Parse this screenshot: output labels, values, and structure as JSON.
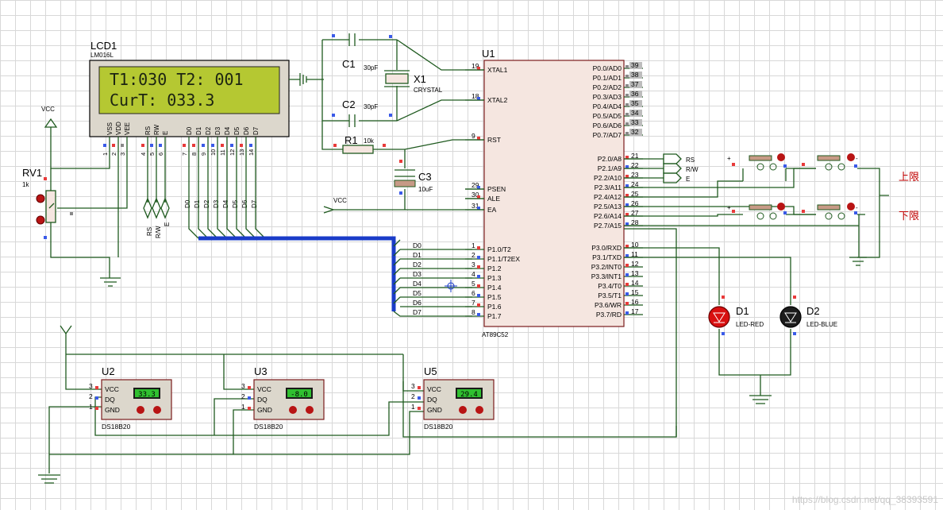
{
  "lcd": {
    "ref": "LCD1",
    "model": "LM016L",
    "line1": "T1:030 T2: 001",
    "line2": "CurT: 033.3",
    "pins": [
      "VSS",
      "VDD",
      "VEE",
      "RS",
      "RW",
      "E",
      "D0",
      "D1",
      "D2",
      "D3",
      "D4",
      "D5",
      "D6",
      "D7"
    ],
    "pin_numbers": [
      "1",
      "2",
      "3",
      "4",
      "5",
      "6",
      "7",
      "8",
      "9",
      "10",
      "11",
      "12",
      "13",
      "14"
    ],
    "lower_labels": [
      "RS",
      "R/W",
      "E",
      "D0",
      "D1",
      "D2",
      "D3",
      "D4",
      "D5",
      "D6",
      "D7"
    ]
  },
  "mcu": {
    "ref": "U1",
    "model": "AT89C52",
    "left_pins": [
      {
        "num": "19",
        "name": "XTAL1"
      },
      {
        "num": "18",
        "name": "XTAL2"
      },
      {
        "num": "9",
        "name": "RST"
      },
      {
        "num": "29",
        "name": "PSEN"
      },
      {
        "num": "30",
        "name": "ALE"
      },
      {
        "num": "31",
        "name": "EA"
      },
      {
        "num": "1",
        "name": "P1.0/T2"
      },
      {
        "num": "2",
        "name": "P1.1/T2EX"
      },
      {
        "num": "3",
        "name": "P1.2"
      },
      {
        "num": "4",
        "name": "P1.3"
      },
      {
        "num": "5",
        "name": "P1.4"
      },
      {
        "num": "6",
        "name": "P1.5"
      },
      {
        "num": "7",
        "name": "P1.6"
      },
      {
        "num": "8",
        "name": "P1.7"
      }
    ],
    "right_pins": [
      {
        "num": "39",
        "name": "P0.0/AD0"
      },
      {
        "num": "38",
        "name": "P0.1/AD1"
      },
      {
        "num": "37",
        "name": "P0.2/AD2"
      },
      {
        "num": "36",
        "name": "P0.3/AD3"
      },
      {
        "num": "35",
        "name": "P0.4/AD4"
      },
      {
        "num": "34",
        "name": "P0.5/AD5"
      },
      {
        "num": "33",
        "name": "P0.6/AD6"
      },
      {
        "num": "32",
        "name": "P0.7/AD7"
      },
      {
        "num": "21",
        "name": "P2.0/A8"
      },
      {
        "num": "22",
        "name": "P2.1/A9"
      },
      {
        "num": "23",
        "name": "P2.2/A10"
      },
      {
        "num": "24",
        "name": "P2.3/A11"
      },
      {
        "num": "25",
        "name": "P2.4/A12"
      },
      {
        "num": "26",
        "name": "P2.5/A13"
      },
      {
        "num": "27",
        "name": "P2.6/A14"
      },
      {
        "num": "28",
        "name": "P2.7/A15"
      },
      {
        "num": "10",
        "name": "P3.0/RXD"
      },
      {
        "num": "11",
        "name": "P3.1/TXD"
      },
      {
        "num": "12",
        "name": "P3.2/INT0"
      },
      {
        "num": "13",
        "name": "P3.3/INT1"
      },
      {
        "num": "14",
        "name": "P3.4/T0"
      },
      {
        "num": "15",
        "name": "P3.5/T1"
      },
      {
        "num": "16",
        "name": "P3.6/WR"
      },
      {
        "num": "17",
        "name": "P3.7/RD"
      }
    ]
  },
  "bus_labels": [
    "D0",
    "D1",
    "D2",
    "D3",
    "D4",
    "D5",
    "D6",
    "D7"
  ],
  "port2_labels": [
    "RS",
    "R/W",
    "E"
  ],
  "crystal": {
    "ref": "X1",
    "value": "CRYSTAL"
  },
  "caps": [
    {
      "ref": "C1",
      "value": "30pF"
    },
    {
      "ref": "C2",
      "value": "30pF"
    },
    {
      "ref": "C3",
      "value": "10uF"
    }
  ],
  "resistor": {
    "ref": "R1",
    "value": "10k"
  },
  "pot": {
    "ref": "RV1",
    "value": "1k"
  },
  "vcc": "VCC",
  "leds": [
    {
      "ref": "D1",
      "value": "LED-RED",
      "color": "#d81010"
    },
    {
      "ref": "D2",
      "value": "LED-BLUE",
      "color": "#1030d8"
    }
  ],
  "switch_labels": {
    "upper": "上限",
    "lower": "下限"
  },
  "sensors": [
    {
      "ref": "U2",
      "model": "DS18B20",
      "reading": "33.3"
    },
    {
      "ref": "U3",
      "model": "DS18B20",
      "reading": "-8.0"
    },
    {
      "ref": "U5",
      "model": "DS18B20",
      "reading": "29.4"
    }
  ],
  "sensor_pins": [
    {
      "num": "3",
      "name": "VCC"
    },
    {
      "num": "2",
      "name": "DQ"
    },
    {
      "num": "1",
      "name": "GND"
    }
  ],
  "watermark": "https://blog.csdn.net/qq_38393591",
  "colors": {
    "wire": "#1f5a1f",
    "bus": "#1a3cc8",
    "lcd_screen": "#b5c832",
    "chip_fill": "#f5e6e0"
  }
}
